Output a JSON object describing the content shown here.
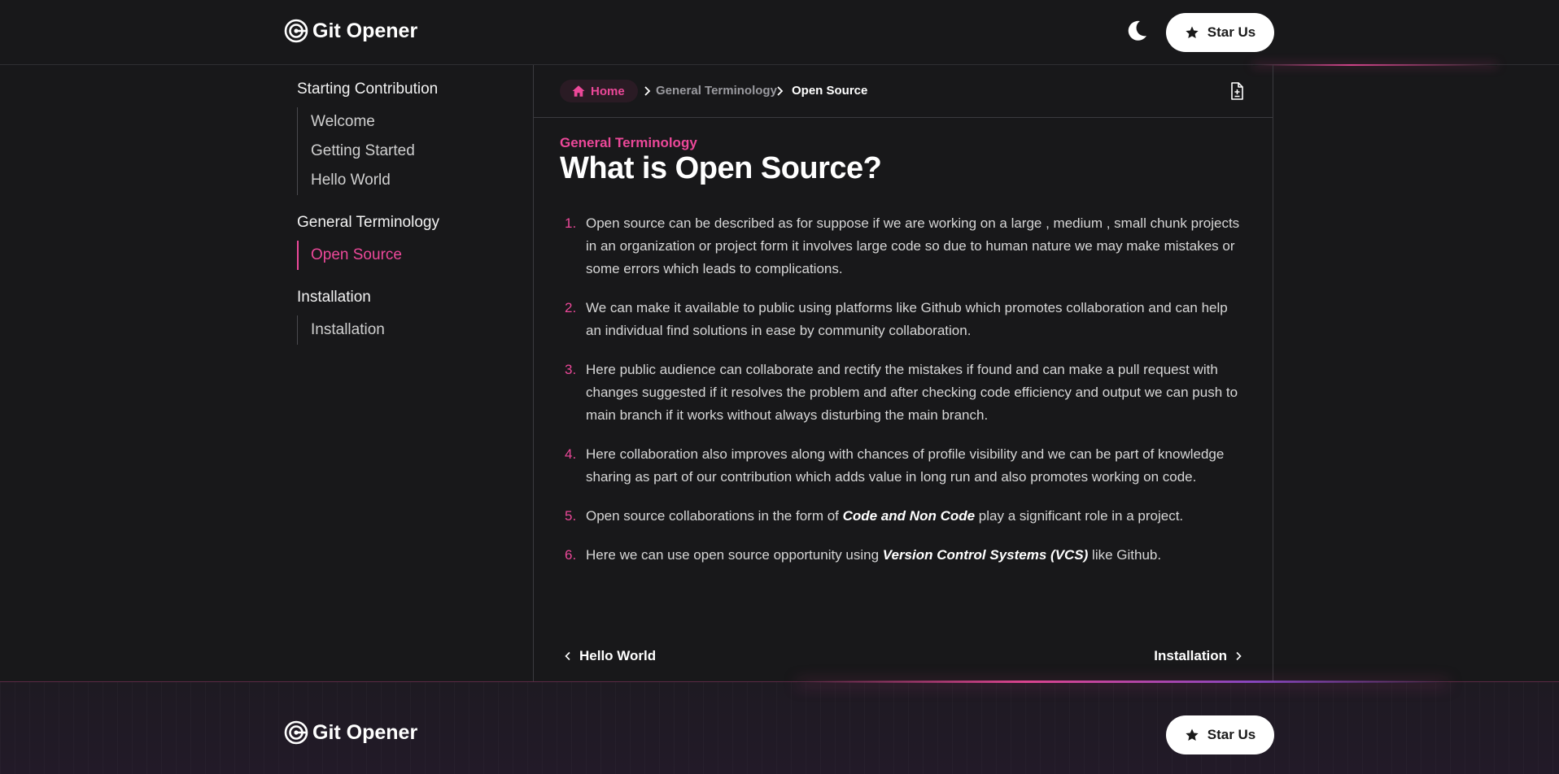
{
  "header": {
    "logo_text": "Git Opener",
    "star_button": "Star Us"
  },
  "sidebar": {
    "sections": [
      {
        "title": "Starting Contribution",
        "items": [
          "Welcome",
          "Getting Started",
          "Hello World"
        ]
      },
      {
        "title": "General Terminology",
        "items": [
          "Open Source"
        ]
      },
      {
        "title": "Installation",
        "items": [
          "Installation"
        ]
      }
    ],
    "active_item": "Open Source"
  },
  "breadcrumb": {
    "home": "Home",
    "middle": "General Terminology",
    "current": "Open Source"
  },
  "article": {
    "category": "General Terminology",
    "title": "What is Open Source?",
    "points": [
      {
        "num": "1.",
        "parts": [
          {
            "t": "Open source can be described as for suppose if we are working on a large , medium , small chunk projects in an organization or project form it involves large code so due to human nature we may make mistakes or some errors which leads to complications."
          }
        ]
      },
      {
        "num": "2.",
        "parts": [
          {
            "t": "We can make it available to public using platforms like Github which promotes collaboration and can help an individual find solutions in ease by community collaboration."
          }
        ]
      },
      {
        "num": "3.",
        "parts": [
          {
            "t": "Here public audience can collaborate and rectify the mistakes if found and can make a pull request with changes suggested if it resolves the problem and after checking code efficiency and output we can push to main branch if it works without always disturbing the main branch."
          }
        ]
      },
      {
        "num": "4.",
        "parts": [
          {
            "t": "Here collaboration also improves along with chances of profile visibility and we can be part of knowledge sharing as part of our contribution which adds value in long run and also promotes working on code."
          }
        ]
      },
      {
        "num": "5.",
        "parts": [
          {
            "t": "Open source collaborations in the form of "
          },
          {
            "t": "Code and Non Code",
            "em": true
          },
          {
            "t": " play a significant role in a project."
          }
        ]
      },
      {
        "num": "6.",
        "parts": [
          {
            "t": "Here we can use open source opportunity using "
          },
          {
            "t": "Version Control Systems (VCS)",
            "em": true
          },
          {
            "t": " like Github."
          }
        ]
      }
    ]
  },
  "pager": {
    "prev": "Hello World",
    "next": "Installation"
  },
  "footer": {
    "logo_text": "Git Opener",
    "star_button": "Star Us"
  },
  "colors": {
    "accent": "#ec4899",
    "background": "#18181a"
  }
}
